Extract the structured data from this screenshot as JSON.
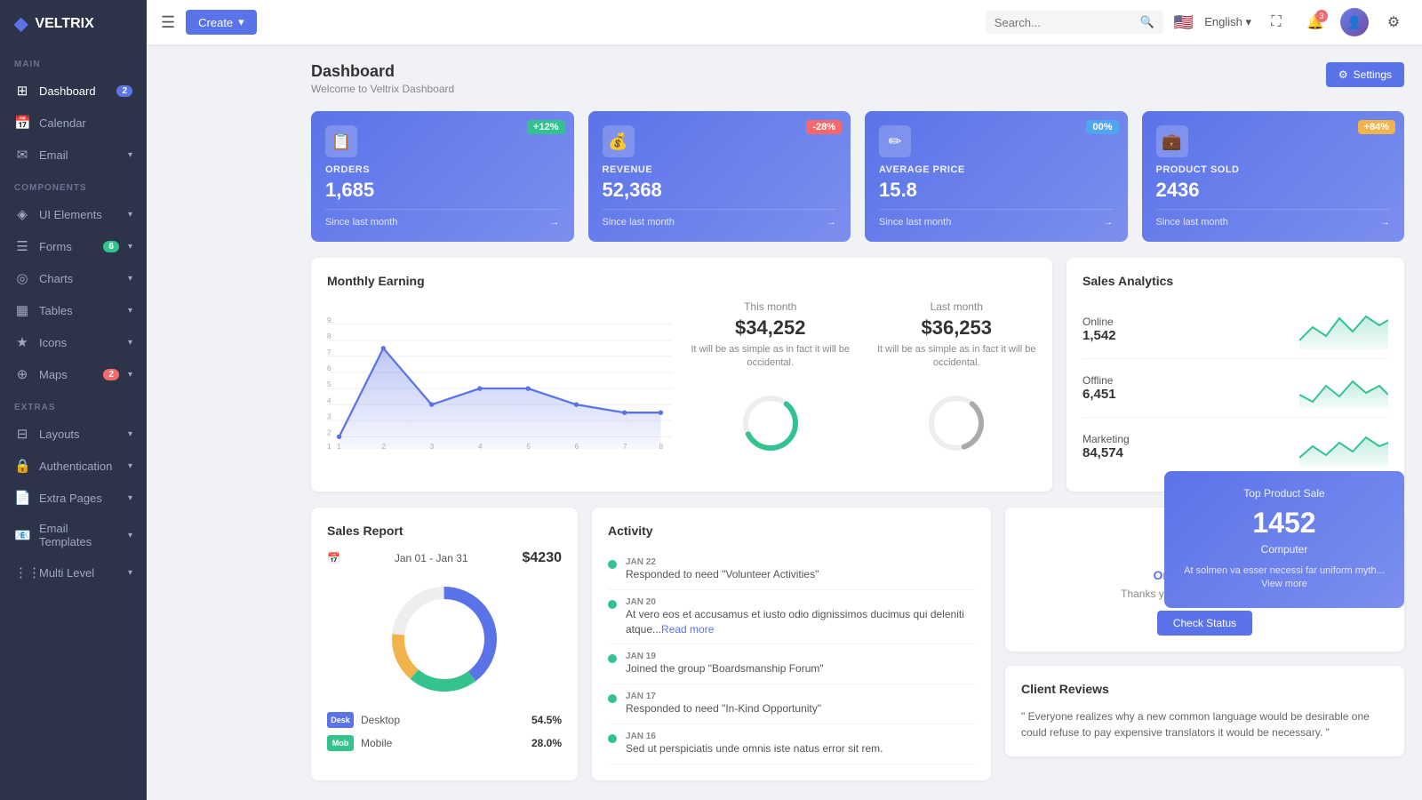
{
  "app": {
    "name": "VELTRIX"
  },
  "topbar": {
    "create_label": "Create",
    "search_placeholder": "Search...",
    "language": "English",
    "notif_count": "3"
  },
  "sidebar": {
    "sections": [
      {
        "label": "MAIN",
        "items": [
          {
            "id": "dashboard",
            "label": "Dashboard",
            "icon": "⊞",
            "badge": "2",
            "badge_color": "blue",
            "active": true
          },
          {
            "id": "calendar",
            "label": "Calendar",
            "icon": "📅",
            "badge": "",
            "badge_color": ""
          },
          {
            "id": "email",
            "label": "Email",
            "icon": "✉",
            "badge": "",
            "badge_color": "",
            "has_arrow": true
          }
        ]
      },
      {
        "label": "COMPONENTS",
        "items": [
          {
            "id": "ui-elements",
            "label": "UI Elements",
            "icon": "◈",
            "badge": "",
            "badge_color": "",
            "has_arrow": true
          },
          {
            "id": "forms",
            "label": "Forms",
            "icon": "☰",
            "badge": "6",
            "badge_color": "green",
            "has_arrow": true
          },
          {
            "id": "charts",
            "label": "Charts",
            "icon": "◎",
            "badge": "",
            "badge_color": "",
            "has_arrow": true
          },
          {
            "id": "tables",
            "label": "Tables",
            "icon": "▦",
            "badge": "",
            "badge_color": "",
            "has_arrow": true
          },
          {
            "id": "icons",
            "label": "Icons",
            "icon": "★",
            "badge": "",
            "badge_color": "",
            "has_arrow": true
          },
          {
            "id": "maps",
            "label": "Maps",
            "icon": "⊕",
            "badge": "2",
            "badge_color": "red",
            "has_arrow": true
          }
        ]
      },
      {
        "label": "EXTRAS",
        "items": [
          {
            "id": "layouts",
            "label": "Layouts",
            "icon": "⊟",
            "badge": "",
            "badge_color": "",
            "has_arrow": true
          },
          {
            "id": "authentication",
            "label": "Authentication",
            "icon": "🔒",
            "badge": "",
            "badge_color": "",
            "has_arrow": true
          },
          {
            "id": "extra-pages",
            "label": "Extra Pages",
            "icon": "📄",
            "badge": "",
            "badge_color": "",
            "has_arrow": true
          },
          {
            "id": "email-templates",
            "label": "Email Templates",
            "icon": "📧",
            "badge": "",
            "badge_color": "",
            "has_arrow": true
          },
          {
            "id": "multi-level",
            "label": "Multi Level",
            "icon": "⋮",
            "badge": "",
            "badge_color": "",
            "has_arrow": true
          }
        ]
      }
    ]
  },
  "page": {
    "title": "Dashboard",
    "subtitle": "Welcome to Veltrix Dashboard",
    "settings_label": "Settings"
  },
  "stat_cards": [
    {
      "id": "orders",
      "label": "ORDERS",
      "value": "1,685",
      "badge": "+12%",
      "badge_color": "green",
      "footer": "Since last month",
      "icon": "📋"
    },
    {
      "id": "revenue",
      "label": "REVENUE",
      "value": "52,368",
      "badge": "-28%",
      "badge_color": "red",
      "footer": "Since last month",
      "icon": "💰"
    },
    {
      "id": "average-price",
      "label": "AVERAGE PRICE",
      "value": "15.8",
      "badge": "00%",
      "badge_color": "teal",
      "footer": "Since last month",
      "icon": "✏"
    },
    {
      "id": "product-sold",
      "label": "PRODUCT SOLD",
      "value": "2436",
      "badge": "+84%",
      "badge_color": "orange",
      "footer": "Since last month",
      "icon": "💼"
    }
  ],
  "monthly_earning": {
    "title": "Monthly Earning",
    "this_month_label": "This month",
    "this_month_value": "$34,252",
    "this_month_desc": "It will be as simple as in fact it will be occidental.",
    "last_month_label": "Last month",
    "last_month_value": "$36,253",
    "last_month_desc": "It will be as simple as in fact it will be occidental."
  },
  "sales_analytics": {
    "title": "Sales Analytics",
    "items": [
      {
        "label": "Online",
        "value": "1,542"
      },
      {
        "label": "Offline",
        "value": "6,451"
      },
      {
        "label": "Marketing",
        "value": "84,574"
      }
    ]
  },
  "sales_report": {
    "title": "Sales Report",
    "date_range": "Jan 01 - Jan 31",
    "total": "$4230",
    "devices": [
      {
        "label": "Desktop",
        "short": "Desk",
        "pct": "54.5%",
        "color": "#5b73e8"
      },
      {
        "label": "Mobile",
        "short": "Mob",
        "pct": "28.0%",
        "color": "#34c38f"
      }
    ]
  },
  "activity": {
    "title": "Activity",
    "items": [
      {
        "date": "JAN 22",
        "text": "Responded to need \"Volunteer Activities\""
      },
      {
        "date": "JAN 20",
        "text": "At vero eos et accusamus et iusto odio dignissimos ducimus qui deleniti atque...",
        "readmore": "Read more"
      },
      {
        "date": "JAN 19",
        "text": "Joined the group \"Boardsmanship Forum\""
      },
      {
        "date": "JAN 17",
        "text": "Responded to need \"In-Kind Opportunity\""
      },
      {
        "date": "JAN 16",
        "text": "Sed ut perspiciatis unde omnis iste natus error sit rem."
      }
    ]
  },
  "order_success": {
    "title": "Order Successful",
    "desc": "Thanks you so much for your order.",
    "btn_label": "Check Status"
  },
  "client_reviews": {
    "title": "Client Reviews",
    "quote": "\" Everyone realizes why a new common language would be desirable one could refuse to pay expensive translators it would be necessary. \""
  },
  "top_product": {
    "label": "Top Product Sale",
    "value": "1452",
    "product": "Computer",
    "desc": "At solmen va esser necessi far uniform myth...",
    "viewmore": "View more"
  }
}
